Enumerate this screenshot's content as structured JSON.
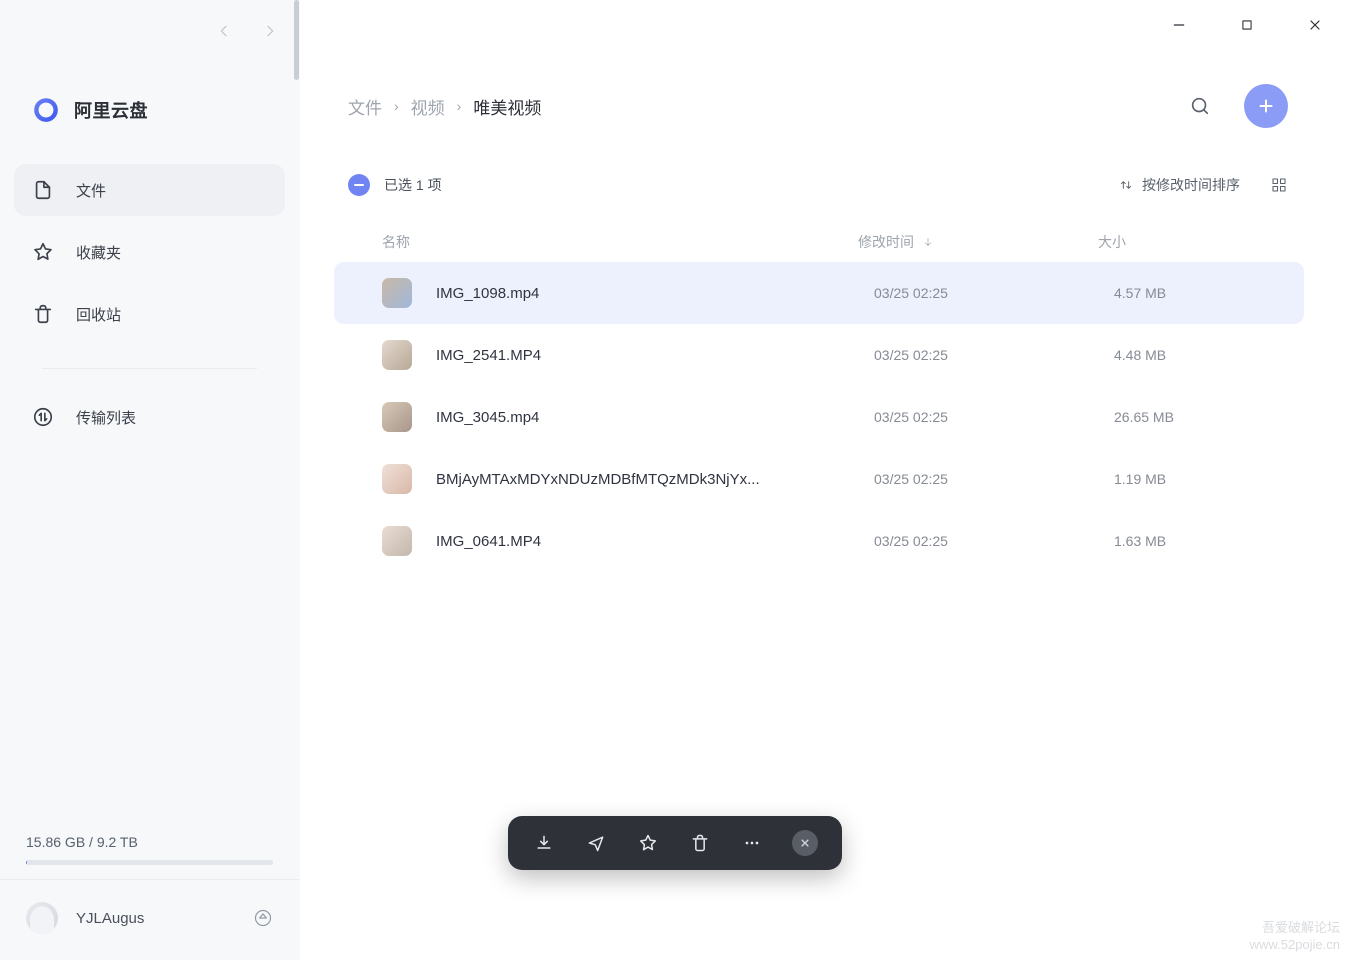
{
  "app": {
    "name": "阿里云盘"
  },
  "sidebar": {
    "items": [
      {
        "label": "文件",
        "active": true
      },
      {
        "label": "收藏夹",
        "active": false
      },
      {
        "label": "回收站",
        "active": false
      }
    ],
    "transfer_label": "传输列表"
  },
  "storage": {
    "text": "15.86 GB / 9.2 TB",
    "percent": 0.17
  },
  "user": {
    "name": "YJLAugus"
  },
  "breadcrumb": {
    "items": [
      {
        "label": "文件"
      },
      {
        "label": "视频"
      },
      {
        "label": "唯美视频"
      }
    ]
  },
  "selection": {
    "text": "已选 1 项"
  },
  "sort": {
    "label": "按修改时间排序"
  },
  "columns": {
    "name": "名称",
    "time": "修改时间",
    "size": "大小"
  },
  "files": [
    {
      "name": "IMG_1098.mp4",
      "time": "03/25 02:25",
      "size": "4.57 MB",
      "selected": true
    },
    {
      "name": "IMG_2541.MP4",
      "time": "03/25 02:25",
      "size": "4.48 MB",
      "selected": false
    },
    {
      "name": "IMG_3045.mp4",
      "time": "03/25 02:25",
      "size": "26.65 MB",
      "selected": false
    },
    {
      "name": "BMjAyMTAxMDYxNDUzMDBfMTQzMDk3NjYx...",
      "time": "03/25 02:25",
      "size": "1.19 MB",
      "selected": false
    },
    {
      "name": "IMG_0641.MP4",
      "time": "03/25 02:25",
      "size": "1.63 MB",
      "selected": false
    }
  ],
  "watermark": {
    "line1": "吾爱破解论坛",
    "line2": "www.52pojie.cn"
  }
}
